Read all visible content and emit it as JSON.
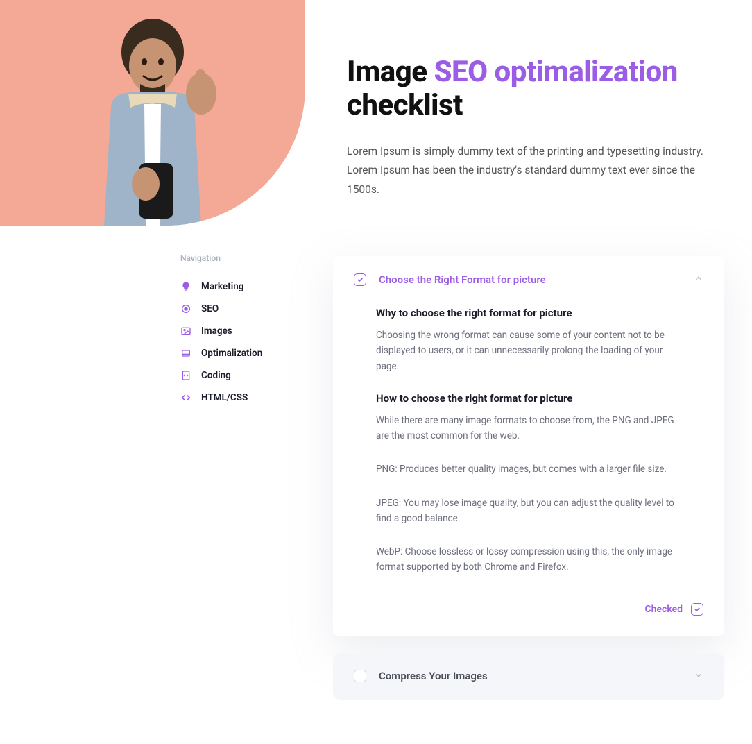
{
  "hero": {
    "title_pre": "Image ",
    "title_accent": "SEO optimalization",
    "title_post": " checklist",
    "description": "Lorem Ipsum is simply dummy text of the printing and typesetting industry. Lorem Ipsum has been the industry's standard dummy text ever since the 1500s."
  },
  "sidebar": {
    "heading": "Navigation",
    "items": [
      {
        "icon": "bulb-icon",
        "label": "Marketing"
      },
      {
        "icon": "target-icon",
        "label": "SEO"
      },
      {
        "icon": "photo-icon",
        "label": "Images"
      },
      {
        "icon": "layers-icon",
        "label": "Optimalization"
      },
      {
        "icon": "code-file-icon",
        "label": "Coding"
      },
      {
        "icon": "code-icon",
        "label": "HTML/CSS"
      }
    ]
  },
  "checklist": {
    "item1": {
      "title": "Choose the Right Format for picture",
      "section1_title": "Why to choose the right format for picture",
      "section1_text": "Choosing the wrong format can cause some of your content not to be displayed to users, or it can unnecessarily prolong the loading of your page.",
      "section2_title": "How to choose the right format for picture",
      "section2_text1": "While there are many image formats to choose from, the PNG and JPEG are the most common for the web.",
      "section2_text2": "PNG: Produces better quality images, but comes with a larger file size.",
      "section2_text3": "JPEG: You may lose image quality, but you can adjust the quality level to find a good balance.",
      "section2_text4": "WebP: Choose lossless or lossy compression using this, the only image format supported by both Chrome and Firefox.",
      "checked_label": "Checked"
    },
    "item2": {
      "title": "Compress Your Images"
    }
  }
}
